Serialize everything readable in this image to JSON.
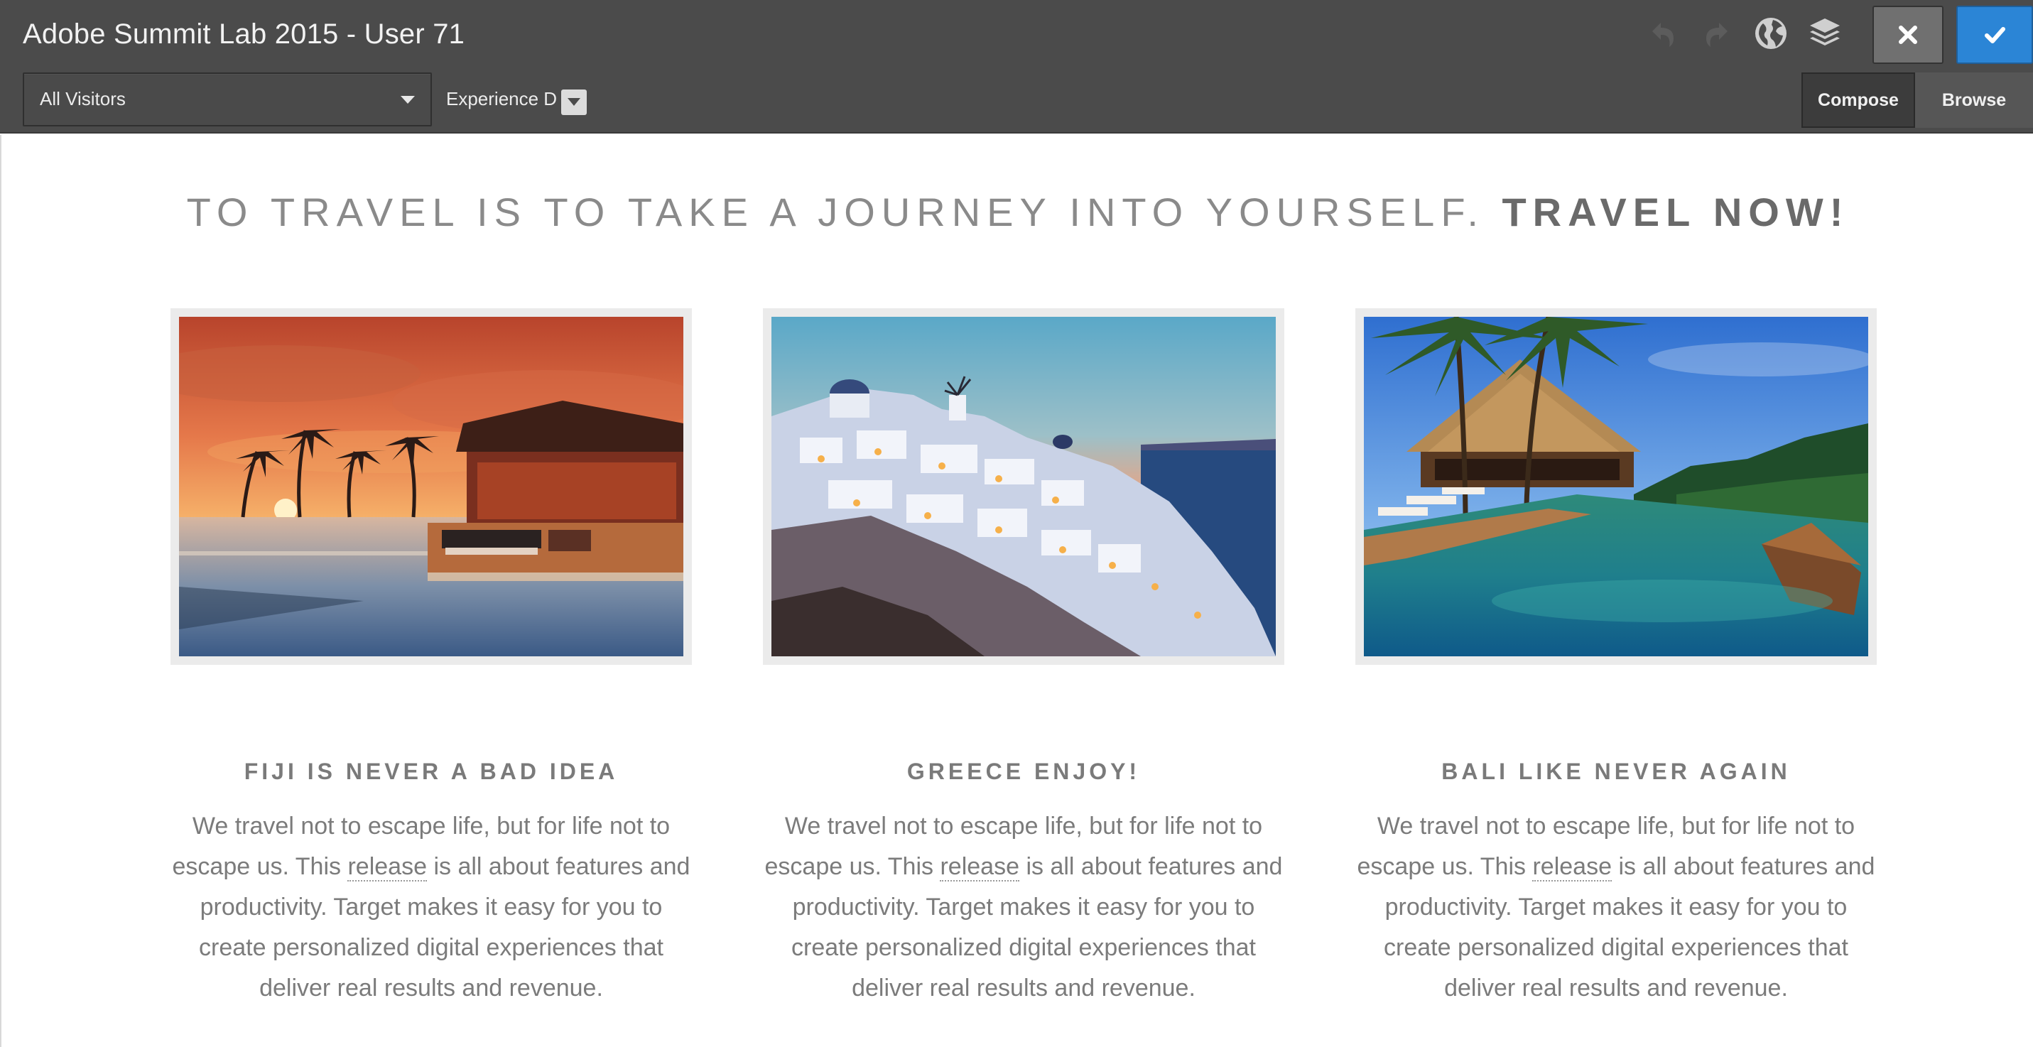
{
  "app": {
    "title": "Adobe Summit Lab 2015 - User 71"
  },
  "toolbar": {
    "audience_selected": "All Visitors",
    "experience_label": "Experience D",
    "icons": [
      "undo-icon",
      "redo-icon",
      "globe-icon",
      "layers-icon",
      "close-icon",
      "checkmark-icon"
    ],
    "modes": [
      "Compose",
      "Browse"
    ],
    "active_mode": "Compose",
    "accent_color": "#2b85d6"
  },
  "page": {
    "headline_main": "TO TRAVEL IS TO TAKE A JOURNEY INTO YOURSELF.",
    "headline_strong": "TRAVEL NOW!",
    "cards": [
      {
        "image": "fiji-resort-sunset-photo",
        "title": "FIJI IS NEVER A BAD IDEA",
        "body_before": "We travel not to escape life, but for life not to escape us. This",
        "link": "release",
        "body_after": "is all about features and productivity. Target makes it easy for you to create personalized digital experiences that deliver real results and revenue."
      },
      {
        "image": "santorini-greece-dusk-photo",
        "title": "GREECE ENJOY!",
        "body_before": "We travel not to escape life, but for life not to escape us. This",
        "link": "release",
        "body_after": "is all about features and productivity. Target makes it easy for you to create personalized digital experiences that deliver real results and revenue."
      },
      {
        "image": "bali-infinity-pool-photo",
        "title": "BALI LIKE NEVER AGAIN",
        "body_before": "We travel not to escape life, but for life not to escape us. This",
        "link": "release",
        "body_after": "is all about features and productivity. Target makes it easy for you to create personalized digital experiences that deliver real results and revenue."
      }
    ]
  }
}
